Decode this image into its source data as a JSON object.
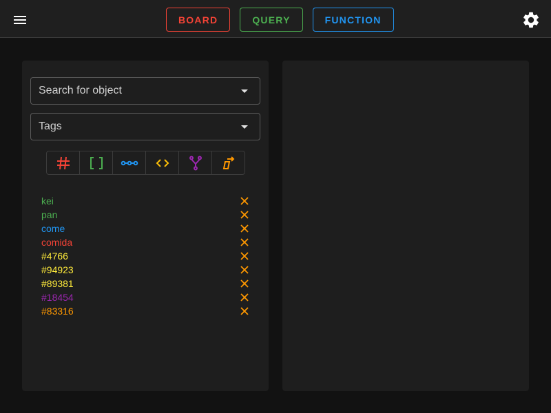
{
  "nav": {
    "buttons": [
      {
        "label": "BOARD",
        "color": "#f44336"
      },
      {
        "label": "QUERY",
        "color": "#4caf50"
      },
      {
        "label": "FUNCTION",
        "color": "#2196f3"
      }
    ]
  },
  "icons": {
    "menu": "menu-icon",
    "settings": "gear-icon",
    "remove": "close-icon"
  },
  "search": {
    "placeholder": "Search for object"
  },
  "tags_select": {
    "placeholder": "Tags"
  },
  "type_filters": [
    {
      "name": "number",
      "icon": "hash-icon",
      "color": "#f44336"
    },
    {
      "name": "array",
      "icon": "brackets-icon",
      "color": "#4caf50"
    },
    {
      "name": "relation",
      "icon": "link-nodes-icon",
      "color": "#2196f3"
    },
    {
      "name": "code",
      "icon": "code-icon",
      "color": "#ffc107"
    },
    {
      "name": "fork",
      "icon": "fork-icon",
      "color": "#9c27b0"
    },
    {
      "name": "export",
      "icon": "export-icon",
      "color": "#ff9800"
    }
  ],
  "tags": [
    {
      "label": "kei",
      "color": "#4caf50"
    },
    {
      "label": "pan",
      "color": "#4caf50"
    },
    {
      "label": "come",
      "color": "#2196f3"
    },
    {
      "label": "comida",
      "color": "#f44336"
    },
    {
      "label": "#4766",
      "color": "#ffeb3b"
    },
    {
      "label": "#94923",
      "color": "#ffeb3b"
    },
    {
      "label": "#89381",
      "color": "#ffeb3b"
    },
    {
      "label": "#18454",
      "color": "#9c27b0"
    },
    {
      "label": "#83316",
      "color": "#ff9800"
    }
  ],
  "remove_color": "#ff9800"
}
